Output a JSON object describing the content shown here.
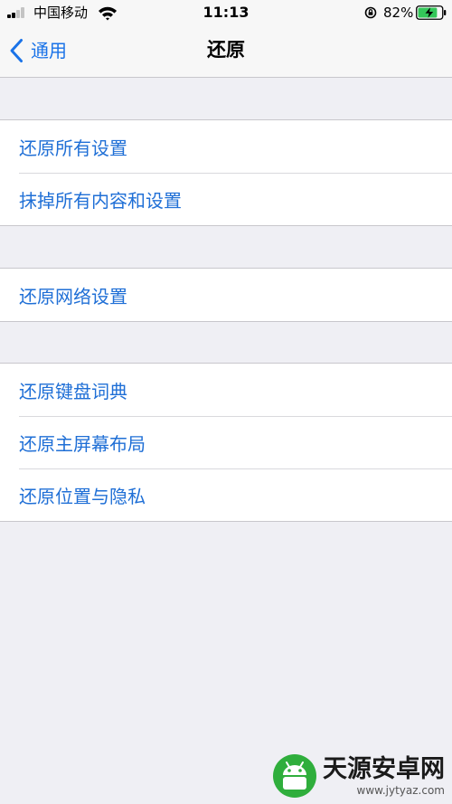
{
  "status_bar": {
    "carrier": "中国移动",
    "time": "11:13",
    "battery_percent": "82%",
    "battery_level": 0.82,
    "icons": [
      "signal-icon",
      "wifi-icon",
      "orientation-lock-icon",
      "battery-charging-icon"
    ]
  },
  "nav": {
    "back_label": "通用",
    "title": "还原"
  },
  "groups": [
    {
      "items": [
        "还原所有设置",
        "抹掉所有内容和设置"
      ]
    },
    {
      "items": [
        "还原网络设置"
      ]
    },
    {
      "items": [
        "还原键盘词典",
        "还原主屏幕布局",
        "还原位置与隐私"
      ]
    }
  ],
  "watermark": {
    "title": "天源安卓网",
    "url": "www.jytyaz.com"
  },
  "colors": {
    "accent": "#1f6fd6",
    "background": "#efeff4",
    "battery_green": "#34c759",
    "watermark_green": "#2fae3c"
  }
}
